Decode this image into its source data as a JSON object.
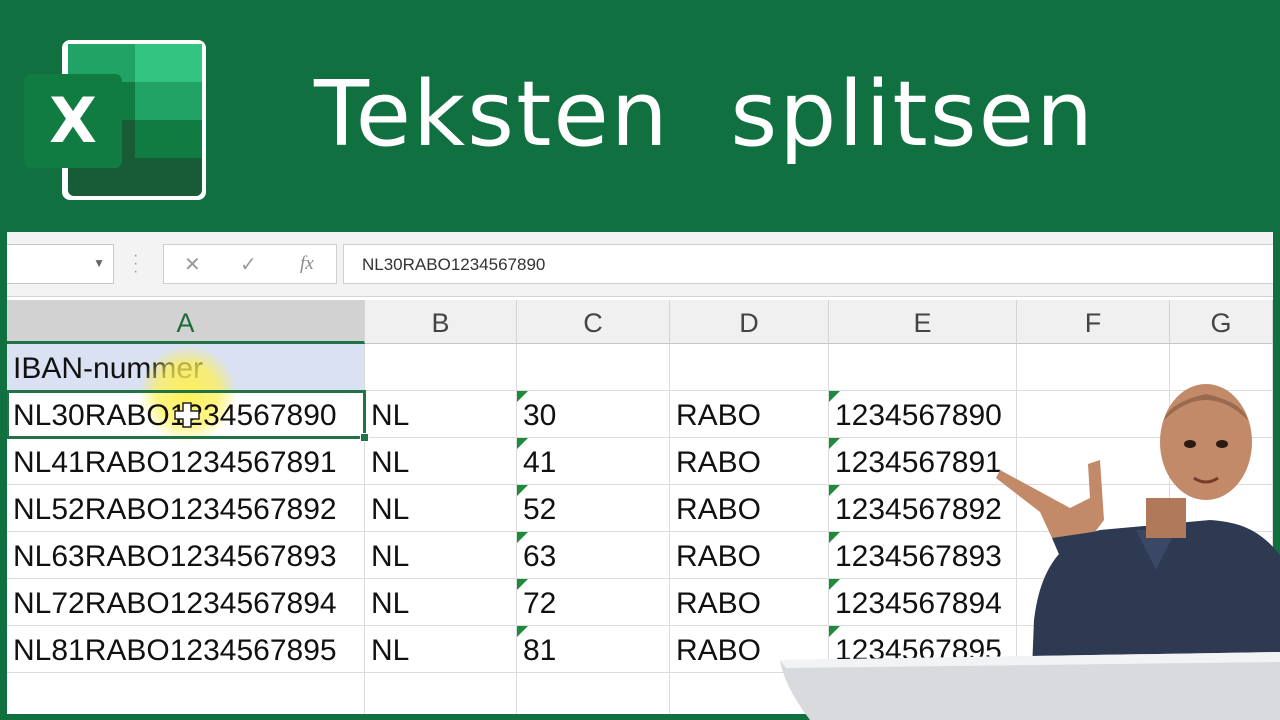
{
  "banner": {
    "title": "Teksten  splitsen",
    "logo_letter": "X",
    "colors": {
      "banner_bg": "#107040",
      "logo_dark": "#185c37",
      "logo_mid": "#21a366",
      "logo_light": "#33c481"
    }
  },
  "formula_bar": {
    "name_box": "",
    "cancel_icon": "✕",
    "enter_icon": "✓",
    "fx_label": "fx",
    "formula": "NL30RABO1234567890"
  },
  "columns": [
    "A",
    "B",
    "C",
    "D",
    "E",
    "F",
    "G"
  ],
  "selected_column": "A",
  "rows": [
    {
      "a": "IBAN-nummer",
      "b": "",
      "c": "",
      "d": "",
      "e": ""
    },
    {
      "a": "NL30RABO1234567890",
      "b": "NL",
      "c": "30",
      "d": "RABO",
      "e": "1234567890"
    },
    {
      "a": "NL41RABO1234567891",
      "b": "NL",
      "c": "41",
      "d": "RABO",
      "e": "1234567891"
    },
    {
      "a": "NL52RABO1234567892",
      "b": "NL",
      "c": "52",
      "d": "RABO",
      "e": "1234567892"
    },
    {
      "a": "NL63RABO1234567893",
      "b": "NL",
      "c": "63",
      "d": "RABO",
      "e": "1234567893"
    },
    {
      "a": "NL72RABO1234567894",
      "b": "NL",
      "c": "72",
      "d": "RABO",
      "e": "1234567894"
    },
    {
      "a": "NL81RABO1234567895",
      "b": "NL",
      "c": "81",
      "d": "RABO",
      "e": "1234567895"
    }
  ],
  "active_cell": "A2",
  "accent_color": "#217346"
}
